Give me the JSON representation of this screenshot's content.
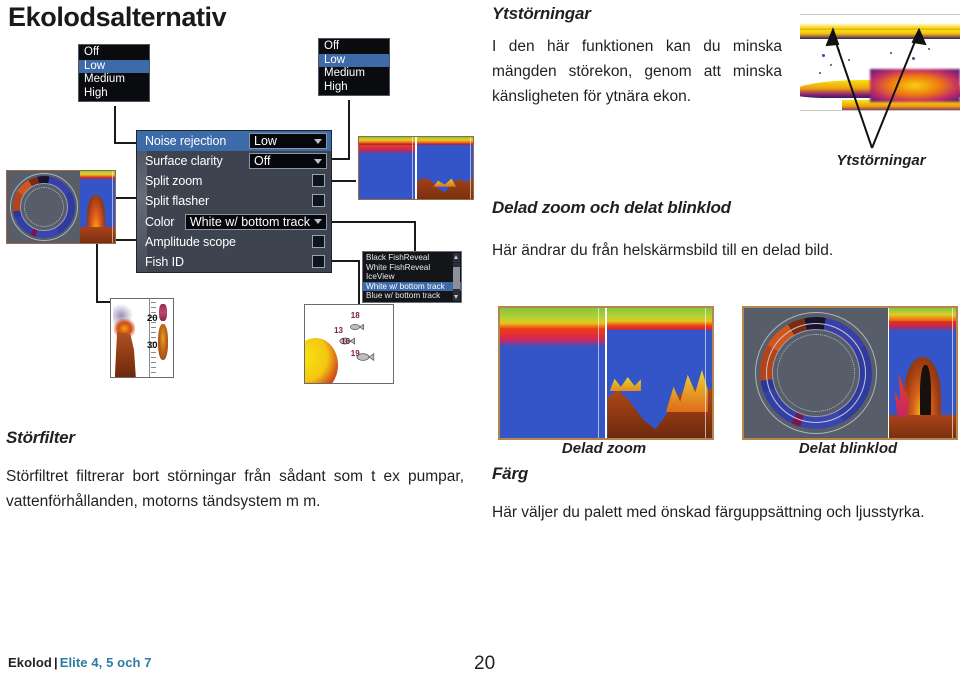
{
  "page": {
    "title": "Ekolodsalternativ",
    "number": "20"
  },
  "footer": {
    "left_dark": "Ekolod",
    "separator": "|",
    "left_blue": "Elite 4, 5 och 7",
    "blue_color": "#2a7ca3"
  },
  "settings_panel": {
    "rows": [
      {
        "label": "Noise rejection",
        "type": "dropdown",
        "value": "Low",
        "selected": true
      },
      {
        "label": "Surface clarity",
        "type": "dropdown",
        "value": "Off",
        "selected": false
      },
      {
        "label": "Split zoom",
        "type": "checkbox",
        "value": "",
        "selected": false
      },
      {
        "label": "Split flasher",
        "type": "checkbox",
        "value": "",
        "selected": false
      },
      {
        "label": "Color",
        "type": "dropdown",
        "value": "White w/ bottom track",
        "selected": false
      },
      {
        "label": "Amplitude scope",
        "type": "checkbox",
        "value": "",
        "selected": false
      },
      {
        "label": "Fish ID",
        "type": "checkbox",
        "value": "",
        "selected": false
      }
    ]
  },
  "dropdown_noise_rejection": {
    "items": [
      "Off",
      "Low",
      "Medium",
      "High"
    ],
    "selected": "Low"
  },
  "dropdown_surface_clarity": {
    "items": [
      "Off",
      "Low",
      "Medium",
      "High"
    ],
    "selected": "Low"
  },
  "dropdown_color": {
    "items": [
      "Black FishReveal",
      "White FishReveal",
      "IceView",
      "White w/ bottom track",
      "Blue w/ bottom track"
    ],
    "selected": "White w/ bottom track"
  },
  "sections": {
    "ytstorningar": {
      "heading": "Ytstörningar",
      "body": "I den här funktionen kan du minska mängden störekon, genom att minska känsligheten för ytnära ekon.",
      "image_caption": "Ytstörningar"
    },
    "delad_zoom": {
      "heading": "Delad zoom och delat blinklod",
      "body": "Här ändrar du från helskärmsbild till en delad bild."
    },
    "storfilter": {
      "heading": "Störfilter",
      "body": "Störfiltret filtrerar bort störningar från sådant som t ex pumpar, vattenförhållanden, motorns tändsystem m m."
    },
    "farg": {
      "heading": "Färg",
      "body": "Här väljer du palett med önskad färguppsättning och ljusstyrka."
    }
  },
  "image_captions": {
    "delad_zoom": "Delad zoom",
    "delat_blinklod": "Delat blinklod"
  },
  "amplitude_scope_labels": [
    "20",
    "30"
  ],
  "fish_id_labels": [
    "18",
    "13",
    "16",
    "19"
  ]
}
